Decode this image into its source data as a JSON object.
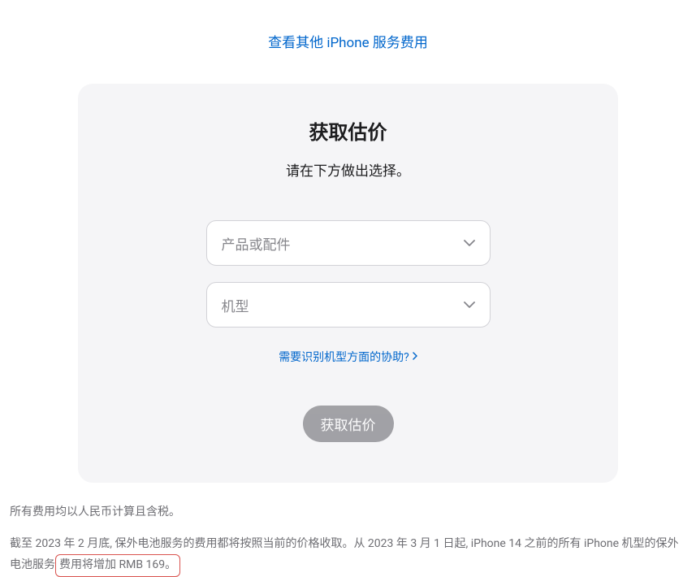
{
  "top_link": {
    "label": "查看其他 iPhone 服务费用"
  },
  "card": {
    "title": "获取估价",
    "subtitle": "请在下方做出选择。",
    "select_product_placeholder": "产品或配件",
    "select_model_placeholder": "机型",
    "help_link": "需要识别机型方面的协助?",
    "submit_button": "获取估价"
  },
  "footer": {
    "line1": "所有费用均以人民币计算且含税。",
    "line2_prefix": "截至 2023 年 2 月底, 保外电池服务的费用都将按照当前的价格收取。从 2023 年 3 月 1 日起, iPhone 14 之前的所有 iPhone 机型的保外电池服务",
    "line2_highlight": "费用将增加 RMB 169。"
  }
}
